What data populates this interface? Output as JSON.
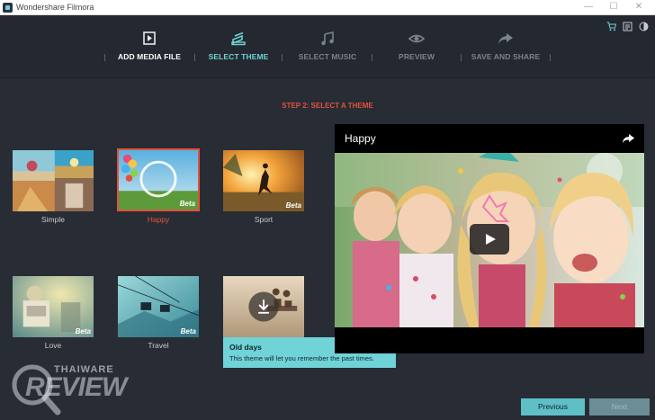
{
  "window": {
    "title": "Wondershare Filmora",
    "controls": [
      "—",
      "☐",
      "✕"
    ]
  },
  "steps": [
    {
      "label": "ADD MEDIA FILE",
      "icon": "import-icon",
      "state": "done"
    },
    {
      "label": "SELECT THEME",
      "icon": "theme-icon",
      "state": "active"
    },
    {
      "label": "SELECT MUSIC",
      "icon": "music-note-icon",
      "state": "inactive"
    },
    {
      "label": "PREVIEW",
      "icon": "eye-icon",
      "state": "inactive"
    },
    {
      "label": "SAVE AND SHARE",
      "icon": "share-arrow-icon",
      "state": "inactive"
    }
  ],
  "header_icons": [
    "cart-icon",
    "register-icon",
    "brightness-icon"
  ],
  "step_heading": "STEP 2: SELECT A THEME",
  "themes": [
    {
      "name": "Simple",
      "beta": "",
      "selected": false
    },
    {
      "name": "Happy",
      "beta": "Beta",
      "selected": true
    },
    {
      "name": "Sport",
      "beta": "Beta",
      "selected": false
    },
    {
      "name": "Love",
      "beta": "Beta",
      "selected": false
    },
    {
      "name": "Travel",
      "beta": "Beta",
      "selected": false
    },
    {
      "name": "Old days",
      "beta": "",
      "selected": false
    }
  ],
  "preview": {
    "title": "Happy"
  },
  "tooltip": {
    "title": "Old days",
    "text": "This theme will let you remember the past times."
  },
  "buttons": {
    "previous": "Previous",
    "next": "Next"
  },
  "watermark": {
    "top": "THAIWARE",
    "main": "REVIEW"
  },
  "colors": {
    "accent": "#e2523c",
    "teal": "#6fd3d8",
    "background": "#282c34"
  }
}
